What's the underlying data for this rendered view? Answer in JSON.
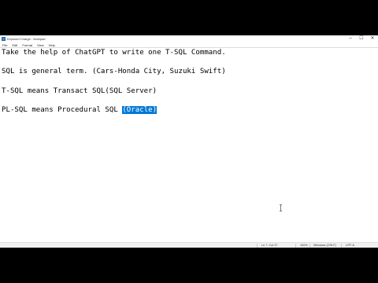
{
  "window": {
    "title": "Keyword Charge - Notepad"
  },
  "controls": {
    "minimize": "–",
    "maximize": "☐",
    "close": "✕"
  },
  "menu": [
    "File",
    "Edit",
    "Format",
    "View",
    "Help"
  ],
  "editor": {
    "line1": "Take the help of ChatGPT to write one T-SQL Command.",
    "line2": "SQL is general term. (Cars-Honda City, Suzuki Swift)",
    "line3": "T-SQL means Transact SQL(SQL Server)",
    "line4_prefix": "PL-SQL means Procedural SQL ",
    "line4_selected": "(Oracle)"
  },
  "status": {
    "position": "Ln 7, Col 37",
    "zoom": "100%",
    "line_ending": "Windows (CRLF)",
    "encoding": "UTF-8"
  }
}
